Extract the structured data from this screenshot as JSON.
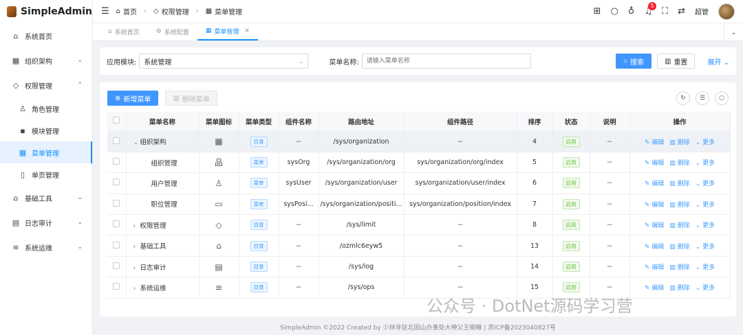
{
  "app": {
    "name": "SimpleAdmin"
  },
  "sidebar": {
    "items": [
      {
        "label": "系统首页",
        "icon": "home-icon",
        "glyph": "⌂"
      },
      {
        "label": "组织架构",
        "icon": "org-icon",
        "glyph": "▦",
        "chevron": "⌄"
      },
      {
        "label": "权限管理",
        "icon": "shield-icon",
        "glyph": "◇",
        "chevron": "⌃"
      },
      {
        "label": "角色管理",
        "icon": "role-icon",
        "glyph": "♙"
      },
      {
        "label": "模块管理",
        "icon": "module-icon",
        "glyph": "▪"
      },
      {
        "label": "菜单管理",
        "icon": "menu-grid-icon",
        "glyph": "▦"
      },
      {
        "label": "单页管理",
        "icon": "book-icon",
        "glyph": "▯"
      },
      {
        "label": "基础工具",
        "icon": "tool-home-icon",
        "glyph": "⌂",
        "chevron": "⌄"
      },
      {
        "label": "日志审计",
        "icon": "log-icon",
        "glyph": "▤",
        "chevron": "⌄"
      },
      {
        "label": "系统运维",
        "icon": "server-icon",
        "glyph": "≡",
        "chevron": "⌄"
      }
    ]
  },
  "header": {
    "breadcrumb": [
      "首页",
      "权限管理",
      "菜单管理"
    ],
    "notification_count": "5",
    "username": "超管"
  },
  "tabs": [
    "系统首页",
    "系统配置",
    "菜单管理"
  ],
  "search": {
    "module_label": "应用模块:",
    "module_value": "系统管理",
    "name_label": "菜单名称:",
    "name_placeholder": "请输入菜单名称",
    "search_btn": "搜索",
    "reset_btn": "重置",
    "expand_btn": "展开"
  },
  "toolbar": {
    "add_btn": "新增菜单",
    "delete_btn": "删除菜单"
  },
  "table": {
    "columns": [
      "菜单名称",
      "菜单图标",
      "菜单类型",
      "组件名称",
      "路由地址",
      "组件路径",
      "排序",
      "状态",
      "说明",
      "操作"
    ],
    "rows": [
      {
        "arrow": "⌄",
        "name": "组织架构",
        "icon": "▦",
        "type": "目录",
        "comp": "--",
        "route": "/sys/organization",
        "path": "--",
        "sort": "4",
        "status": "启用",
        "note": "--",
        "hl": true,
        "indent": 0
      },
      {
        "arrow": "",
        "name": "组织管理",
        "icon": "品",
        "type": "菜单",
        "comp": "sysOrg",
        "route": "/sys/organization/org",
        "path": "sys/organization/org/index",
        "sort": "5",
        "status": "启用",
        "note": "--",
        "indent": 1
      },
      {
        "arrow": "",
        "name": "用户管理",
        "icon": "♙",
        "type": "菜单",
        "comp": "sysUser",
        "route": "/sys/organization/user",
        "path": "sys/organization/user/index",
        "sort": "6",
        "status": "启用",
        "note": "--",
        "indent": 1
      },
      {
        "arrow": "",
        "name": "职位管理",
        "icon": "▭",
        "type": "菜单",
        "comp": "sysPosi...",
        "route": "/sys/organization/positi...",
        "path": "sys/organization/position/index",
        "sort": "7",
        "status": "启用",
        "note": "--",
        "indent": 1
      },
      {
        "arrow": "›",
        "name": "权限管理",
        "icon": "◇",
        "type": "目录",
        "comp": "--",
        "route": "/sys/limit",
        "path": "--",
        "sort": "8",
        "status": "启用",
        "note": "--",
        "indent": 0
      },
      {
        "arrow": "›",
        "name": "基础工具",
        "icon": "⌂",
        "type": "目录",
        "comp": "--",
        "route": "/ozmlc6eyw5",
        "path": "--",
        "sort": "13",
        "status": "启用",
        "note": "--",
        "indent": 0
      },
      {
        "arrow": "›",
        "name": "日志审计",
        "icon": "▤",
        "type": "目录",
        "comp": "--",
        "route": "/sys/log",
        "path": "--",
        "sort": "14",
        "status": "启用",
        "note": "--",
        "indent": 0
      },
      {
        "arrow": "›",
        "name": "系统运维",
        "icon": "≡",
        "type": "目录",
        "comp": "--",
        "route": "/sys/ops",
        "path": "--",
        "sort": "15",
        "status": "启用",
        "note": "--",
        "indent": 0
      }
    ],
    "ops": {
      "edit": "编辑",
      "delete": "删除",
      "more": "更多"
    }
  },
  "footer": "SimpleAdmin ©2022 Created by 少林寺驻北固山办事处大神父王喇嘛 | 苏ICP备2023040827号",
  "watermark": "公众号 · DotNet源码学习营"
}
